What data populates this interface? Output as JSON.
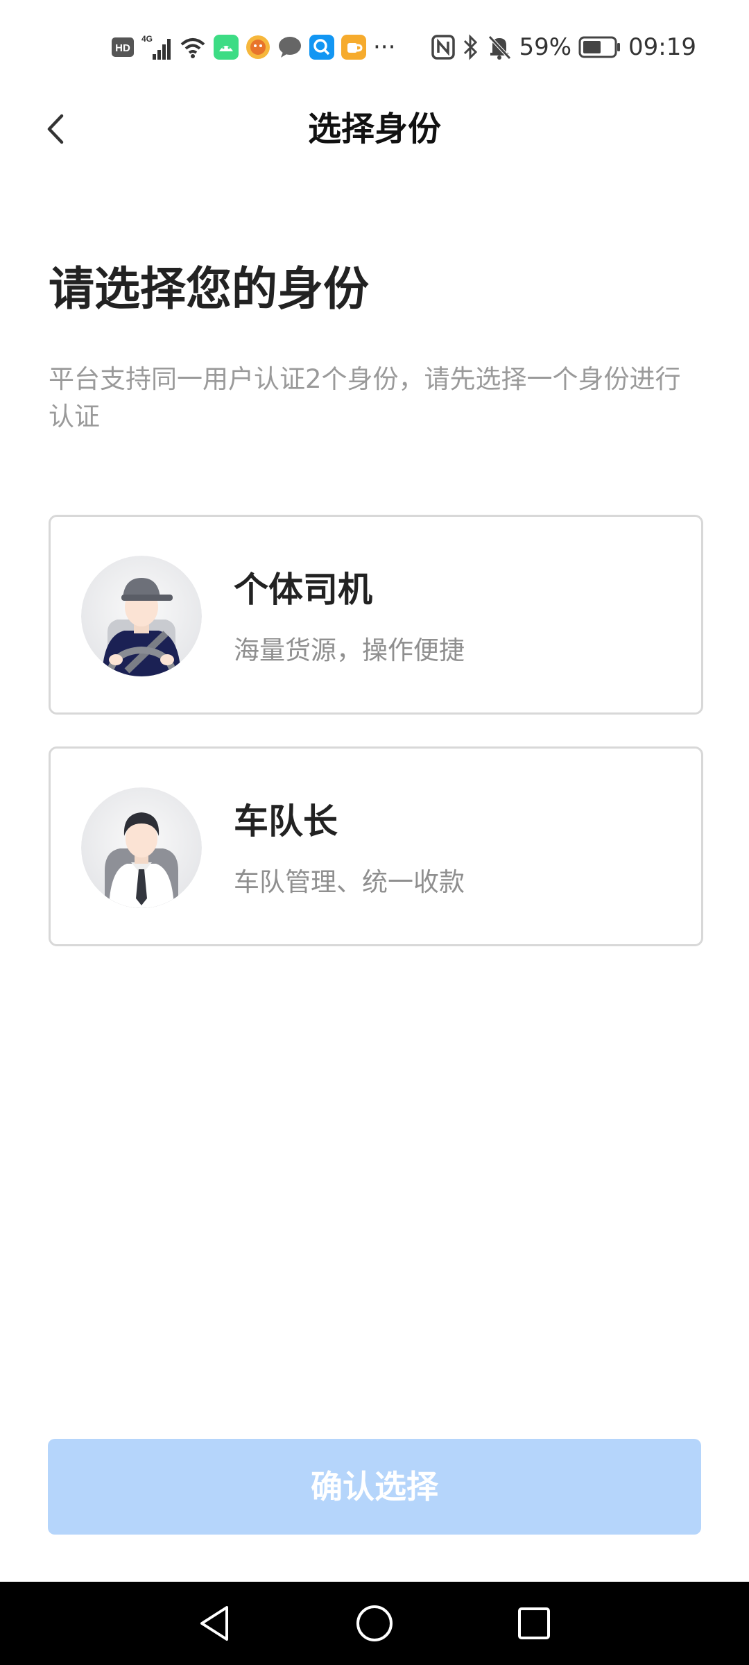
{
  "status_bar": {
    "left_texts": {
      "hd": "HD",
      "network": "4G",
      "more": "···"
    },
    "battery_percent": "59%",
    "time": "09:19",
    "icons": [
      "hd-icon",
      "signal-icon",
      "wifi-icon",
      "android-app-icon",
      "game-app-icon",
      "message-icon",
      "search-app-icon",
      "cup-app-icon",
      "more-icon",
      "nfc-icon",
      "bluetooth-icon",
      "mute-icon",
      "battery-icon"
    ],
    "battery_level": 0.59
  },
  "header": {
    "title": "选择身份"
  },
  "main": {
    "heading": "请选择您的身份",
    "subtitle": "平台支持同一用户认证2个身份，请先选择一个身份进行认证"
  },
  "roles": [
    {
      "title": "个体司机",
      "description": "海量货源，操作便捷",
      "icon": "driver-avatar"
    },
    {
      "title": "车队长",
      "description": "车队管理、统一收款",
      "icon": "fleet-captain-avatar"
    }
  ],
  "confirm_button": {
    "label": "确认选择"
  },
  "colors": {
    "confirm_disabled": "#b5d5fb",
    "card_border": "#d8d8d8",
    "heading_text": "#222222",
    "subtitle_text": "#9a9a9a"
  }
}
